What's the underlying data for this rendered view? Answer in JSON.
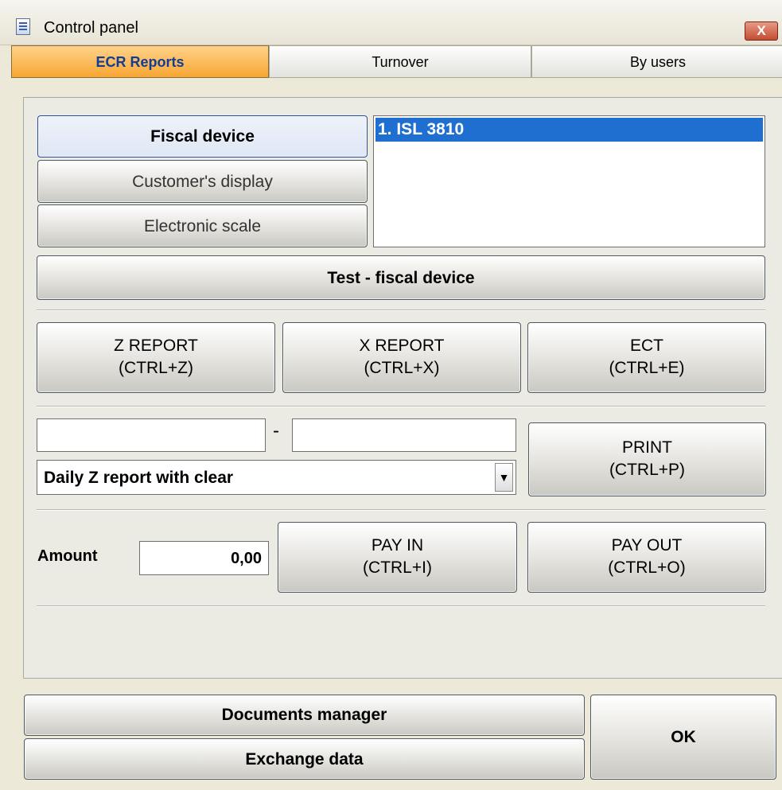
{
  "window": {
    "title": "Control panel",
    "close_symbol": "X"
  },
  "tabs": [
    {
      "label": "ECR Reports",
      "active": true
    },
    {
      "label": "Turnover",
      "active": false
    },
    {
      "label": "By users",
      "active": false
    }
  ],
  "devices": {
    "buttons": [
      {
        "label": "Fiscal device",
        "selected": true
      },
      {
        "label": "Customer's display",
        "selected": false
      },
      {
        "label": "Electronic scale",
        "selected": false
      }
    ],
    "list": [
      {
        "label": "1.  ISL 3810",
        "selected": true
      }
    ],
    "test_button": "Test - fiscal device"
  },
  "reports": [
    {
      "line1": "Z REPORT",
      "line2": "(CTRL+Z)"
    },
    {
      "line1": "X REPORT",
      "line2": "(CTRL+X)"
    },
    {
      "line1": "ECT",
      "line2": "(CTRL+E)"
    }
  ],
  "range": {
    "from_value": "",
    "separator": "-",
    "to_value": "",
    "report_type": "Daily Z report with clear",
    "print_button": {
      "line1": "PRINT",
      "line2": "(CTRL+P)"
    }
  },
  "cash": {
    "amount_label": "Amount",
    "amount_value": "0,00",
    "pay_in": {
      "line1": "PAY IN",
      "line2": "(CTRL+I)"
    },
    "pay_out": {
      "line1": "PAY OUT",
      "line2": "(CTRL+O)"
    }
  },
  "footer": {
    "documents_manager": "Documents manager",
    "exchange_data": "Exchange data",
    "ok": "OK"
  },
  "icons": {
    "window": "document-icon",
    "dropdown": "chevron-down-icon"
  }
}
